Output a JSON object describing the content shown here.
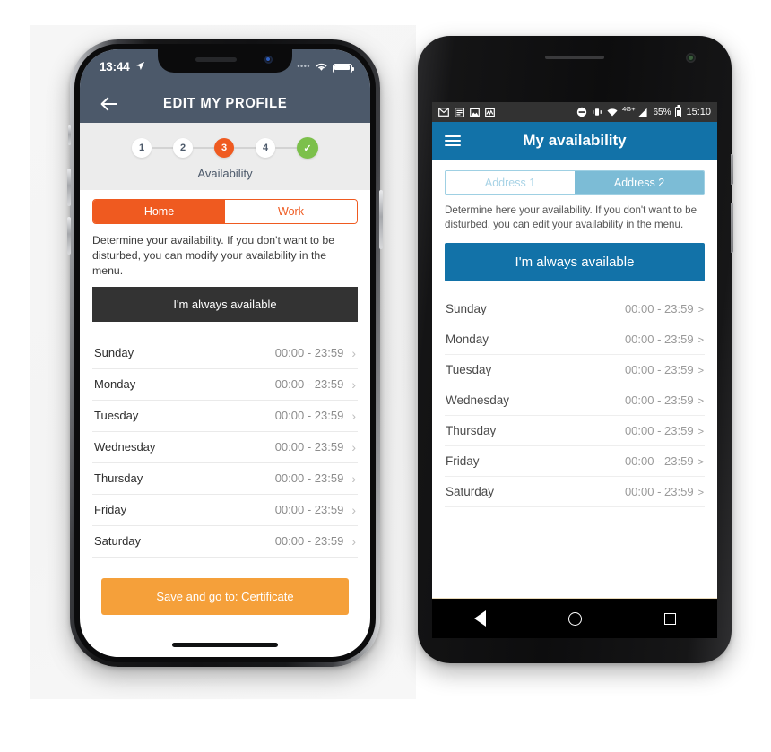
{
  "iphone": {
    "status_bar": {
      "time": "13:44",
      "location_icon": "location-arrow-icon",
      "signal_dots": "••••",
      "wifi_icon": "wifi-icon",
      "battery_icon": "battery-full-icon"
    },
    "nav": {
      "back_icon": "arrow-left-icon",
      "title": "EDIT MY PROFILE"
    },
    "stepper": {
      "steps": [
        {
          "label": "1",
          "state": "pending"
        },
        {
          "label": "2",
          "state": "pending"
        },
        {
          "label": "3",
          "state": "active"
        },
        {
          "label": "4",
          "state": "pending"
        },
        {
          "label": "✓",
          "state": "done"
        }
      ],
      "current_label": "Availability",
      "active_color": "#ef5a20",
      "done_color": "#7cc04b"
    },
    "tabs": [
      {
        "label": "Home",
        "active": true
      },
      {
        "label": "Work",
        "active": false
      }
    ],
    "description": "Determine your availability. If you don't want to be disturbed, you can modify your availability in the menu.",
    "always_available_label": "I'm always available",
    "days": [
      {
        "name": "Sunday",
        "time": "00:00 - 23:59",
        "chevron": "chevron-right-icon"
      },
      {
        "name": "Monday",
        "time": "00:00 - 23:59",
        "chevron": "chevron-right-icon"
      },
      {
        "name": "Tuesday",
        "time": "00:00 - 23:59",
        "chevron": "chevron-right-icon"
      },
      {
        "name": "Wednesday",
        "time": "00:00 - 23:59",
        "chevron": "chevron-right-icon"
      },
      {
        "name": "Thursday",
        "time": "00:00 - 23:59",
        "chevron": "chevron-right-icon"
      },
      {
        "name": "Friday",
        "time": "00:00 - 23:59",
        "chevron": "chevron-right-icon"
      },
      {
        "name": "Saturday",
        "time": "00:00 - 23:59",
        "chevron": "chevron-right-icon"
      }
    ],
    "save_button_label": "Save and go to: Certificate",
    "colors": {
      "header": "#4c596a",
      "accent_orange": "#ef5a20",
      "save_orange": "#f5a03a",
      "dark_button": "#333333"
    }
  },
  "android": {
    "status_bar": {
      "notif_icons": [
        "gmail-icon",
        "calendar-icon",
        "photo-icon",
        "activity-icon"
      ],
      "dnd_icon": "do-not-disturb-icon",
      "vibrate_icon": "vibrate-icon",
      "wifi_icon": "wifi-icon",
      "network_label": "4G+",
      "signal_icon": "signal-bars-icon",
      "battery_percent": "65%",
      "battery_icon": "battery-icon",
      "time": "15:10"
    },
    "appbar": {
      "menu_icon": "hamburger-menu-icon",
      "title": "My availability"
    },
    "address_tabs": [
      {
        "label": "Address 1",
        "active": false
      },
      {
        "label": "Address 2",
        "active": true
      }
    ],
    "description": "Determine here your availability. If you don't want to be disturbed, you can edit your availability in the menu.",
    "always_available_label": "I'm always available",
    "days": [
      {
        "name": "Sunday",
        "time": "00:00 - 23:59",
        "chevron": ">"
      },
      {
        "name": "Monday",
        "time": "00:00 - 23:59",
        "chevron": ">"
      },
      {
        "name": "Tuesday",
        "time": "00:00 - 23:59",
        "chevron": ">"
      },
      {
        "name": "Wednesday",
        "time": "00:00 - 23:59",
        "chevron": ">"
      },
      {
        "name": "Thursday",
        "time": "00:00 - 23:59",
        "chevron": ">"
      },
      {
        "name": "Friday",
        "time": "00:00 - 23:59",
        "chevron": ">"
      },
      {
        "name": "Saturday",
        "time": "00:00 - 23:59",
        "chevron": ">"
      }
    ],
    "nav_buttons": [
      {
        "name": "back-nav-icon"
      },
      {
        "name": "home-nav-icon"
      },
      {
        "name": "recents-nav-icon"
      }
    ],
    "colors": {
      "appbar": "#1272a8",
      "status_bar": "#323232",
      "tab_active": "#7cbcd6",
      "tab_text": "#a8d3e6"
    }
  }
}
